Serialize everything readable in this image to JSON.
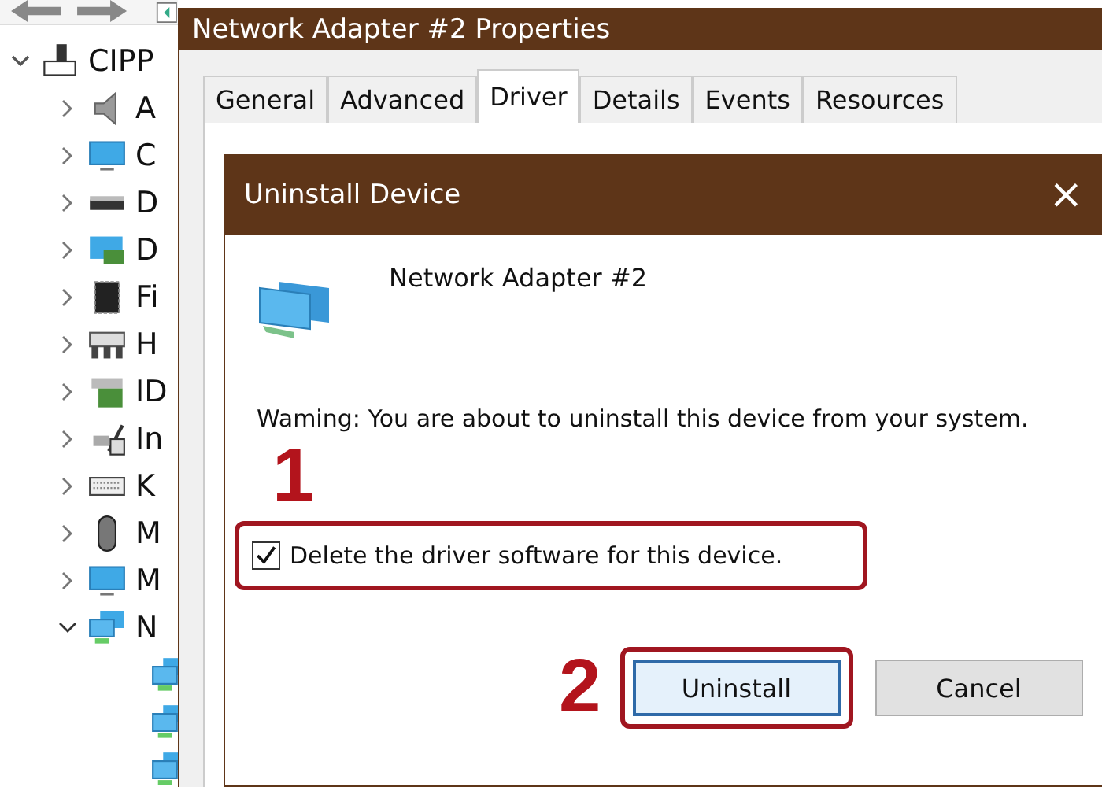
{
  "tree": {
    "label": "CIPP",
    "expanded": true,
    "children": [
      {
        "label": "A",
        "expanded": false
      },
      {
        "label": "C",
        "expanded": false
      },
      {
        "label": "D",
        "expanded": false
      },
      {
        "label": "D",
        "expanded": false
      },
      {
        "label": "Fi",
        "expanded": false
      },
      {
        "label": "H",
        "expanded": false
      },
      {
        "label": "ID",
        "expanded": false
      },
      {
        "label": "In",
        "expanded": false
      },
      {
        "label": "K",
        "expanded": false
      },
      {
        "label": "M",
        "expanded": false
      },
      {
        "label": "M",
        "expanded": false
      },
      {
        "label": "N",
        "expanded": true,
        "children": [
          {
            "kind": "adapter"
          },
          {
            "kind": "adapter"
          },
          {
            "kind": "adapter"
          }
        ]
      }
    ]
  },
  "properties_window": {
    "title": "Network Adapter #2 Properties",
    "tabs": [
      {
        "label": "General",
        "selected": false
      },
      {
        "label": "Advanced",
        "selected": false
      },
      {
        "label": "Driver",
        "selected": true
      },
      {
        "label": "Details",
        "selected": false
      },
      {
        "label": "Events",
        "selected": false
      },
      {
        "label": "Resources",
        "selected": false
      }
    ]
  },
  "dialog": {
    "title": "Uninstall Device",
    "close": "×",
    "device_name": "Network Adapter #2",
    "warning": "Waming: You are about to uninstall this device from your system.",
    "checkbox": {
      "label": "Delete the driver software for this device.",
      "checked": true
    },
    "buttons": [
      {
        "label": "Uninstall",
        "focused": true
      },
      {
        "label": "Cancel",
        "focused": false
      }
    ]
  },
  "annotations": [
    {
      "label": "1"
    },
    {
      "label": "2"
    }
  ]
}
